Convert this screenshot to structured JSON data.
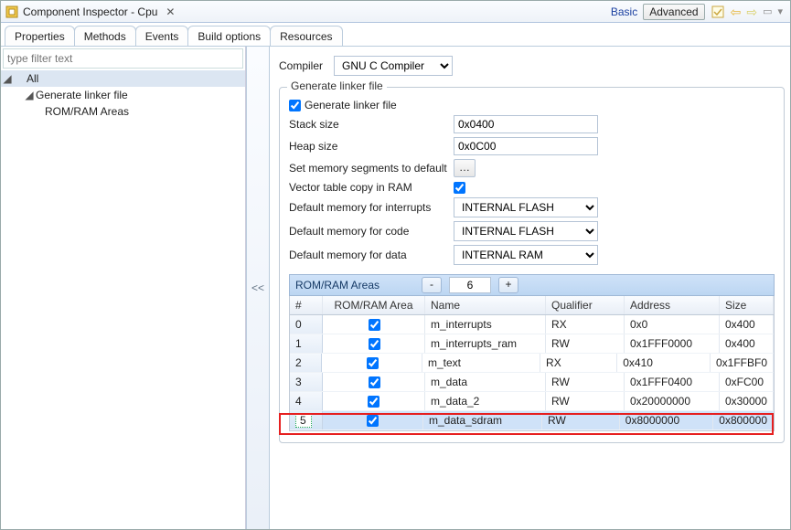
{
  "titlebar": {
    "title": "Component Inspector - Cpu",
    "basic": "Basic",
    "advanced": "Advanced"
  },
  "tabs": {
    "properties": "Properties",
    "methods": "Methods",
    "events": "Events",
    "build": "Build options",
    "resources": "Resources"
  },
  "filter_placeholder": "type filter text",
  "tree": {
    "all": "All",
    "glf": "Generate linker file",
    "rra": "ROM/RAM Areas"
  },
  "splitter_label": "<<",
  "compiler": {
    "label": "Compiler",
    "value": "GNU C Compiler"
  },
  "group_legend": "Generate linker file",
  "glf_check_label": "Generate linker file",
  "stack": {
    "label": "Stack size",
    "value": "0x0400"
  },
  "heap": {
    "label": "Heap size",
    "value": "0x0C00"
  },
  "setdef": {
    "label": "Set memory segments to default"
  },
  "vtcr": {
    "label": "Vector table copy in RAM"
  },
  "dmi": {
    "label": "Default memory for interrupts",
    "value": "INTERNAL FLASH"
  },
  "dmc": {
    "label": "Default memory for code",
    "value": "INTERNAL FLASH"
  },
  "dmd": {
    "label": "Default memory for data",
    "value": "INTERNAL RAM"
  },
  "section": {
    "title": "ROM/RAM Areas",
    "count": "6",
    "minus": "-",
    "plus": "+"
  },
  "grid": {
    "headers": {
      "idx": "#",
      "chk": "ROM/RAM Area",
      "name": "Name",
      "qual": "Qualifier",
      "addr": "Address",
      "size": "Size"
    },
    "rows": [
      {
        "idx": "0",
        "checked": true,
        "name": "m_interrupts",
        "qual": "RX",
        "addr": "0x0",
        "size": "0x400"
      },
      {
        "idx": "1",
        "checked": true,
        "name": "m_interrupts_ram",
        "qual": "RW",
        "addr": "0x1FFF0000",
        "size": "0x400"
      },
      {
        "idx": "2",
        "checked": true,
        "name": "m_text",
        "qual": "RX",
        "addr": "0x410",
        "size": "0x1FFBF0"
      },
      {
        "idx": "3",
        "checked": true,
        "name": "m_data",
        "qual": "RW",
        "addr": "0x1FFF0400",
        "size": "0xFC00"
      },
      {
        "idx": "4",
        "checked": true,
        "name": "m_data_2",
        "qual": "RW",
        "addr": "0x20000000",
        "size": "0x30000"
      },
      {
        "idx": "5",
        "checked": true,
        "name": "m_data_sdram",
        "qual": "RW",
        "addr": "0x8000000",
        "size": "0x800000"
      }
    ]
  }
}
